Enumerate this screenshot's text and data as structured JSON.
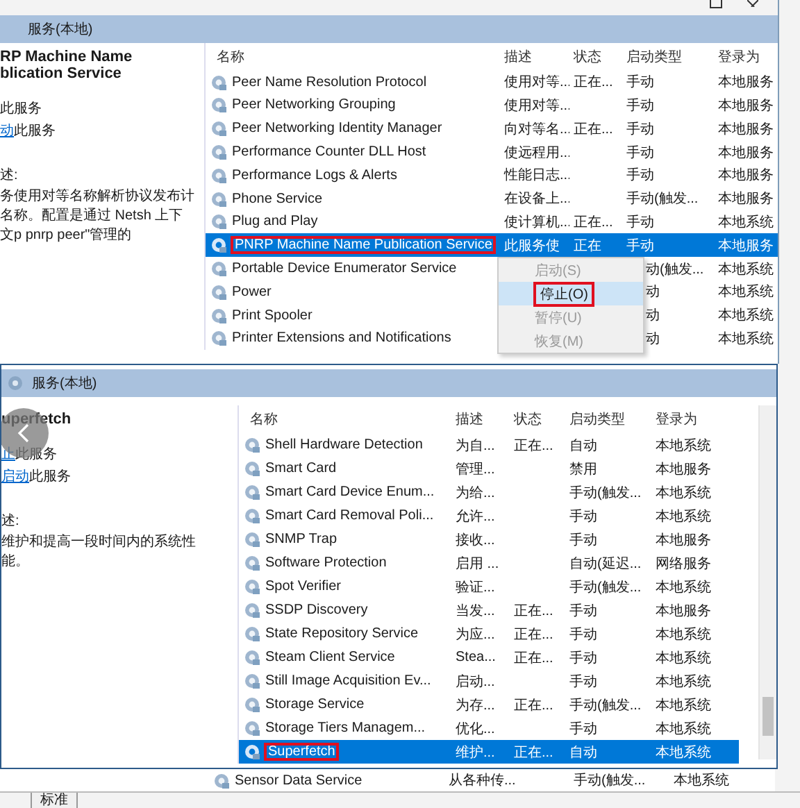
{
  "top_window": {
    "header": "服务(本地)",
    "details": {
      "title": "RP Machine Name\nblication Service",
      "actions": [
        {
          "text": "此服务"
        },
        {
          "link": "动",
          "text": "此服务"
        }
      ],
      "desc_label": "述:",
      "description": "务使用对等名称解析协议发布计名称。配置是通过 Netsh 上下文p pnrp peer\"管理的"
    },
    "columns": [
      "名称",
      "描述",
      "状态",
      "启动类型",
      "登录为"
    ],
    "rows": [
      {
        "name": "Peer Name Resolution Protocol",
        "desc": "使用对等...",
        "status": "正在...",
        "startup": "手动",
        "logon": "本地服务",
        "selected": false,
        "marked": false
      },
      {
        "name": "Peer Networking Grouping",
        "desc": "使用对等...",
        "startup": "手动",
        "logon": "本地服务",
        "selected": false,
        "marked": false
      },
      {
        "name": "Peer Networking Identity Manager",
        "desc": "向对等名...",
        "status": "正在...",
        "startup": "手动",
        "logon": "本地服务",
        "selected": false,
        "marked": false
      },
      {
        "name": "Performance Counter DLL Host",
        "desc": "使远程用...",
        "startup": "手动",
        "logon": "本地服务",
        "selected": false,
        "marked": false
      },
      {
        "name": "Performance Logs & Alerts",
        "desc": "性能日志...",
        "startup": "手动",
        "logon": "本地服务",
        "selected": false,
        "marked": false
      },
      {
        "name": "Phone Service",
        "desc": "在设备上...",
        "startup": "手动(触发...",
        "logon": "本地服务",
        "selected": false,
        "marked": false
      },
      {
        "name": "Plug and Play",
        "desc": "使计算机...",
        "status": "正在...",
        "startup": "手动",
        "logon": "本地系统",
        "selected": false,
        "marked": false
      },
      {
        "name": "PNRP Machine Name Publication Service",
        "desc": "此服务使",
        "status": "正在",
        "startup": "手动",
        "logon": "本地服务",
        "selected": true,
        "marked": true
      },
      {
        "name": "Portable Device Enumerator Service",
        "startup": "动(触发...",
        "logon": "本地系统",
        "selected": false,
        "marked": false
      },
      {
        "name": "Power",
        "startup": "动",
        "logon": "本地系统",
        "selected": false,
        "marked": false
      },
      {
        "name": "Print Spooler",
        "startup": "动",
        "logon": "本地系统",
        "selected": false,
        "marked": false
      },
      {
        "name": "Printer Extensions and Notifications",
        "startup": "动",
        "logon": "本地系统",
        "selected": false,
        "marked": false
      }
    ],
    "context_menu": [
      {
        "label": "启动(S)",
        "disabled": true,
        "selected": false,
        "marked": false
      },
      {
        "label": "停止(O)",
        "disabled": false,
        "selected": true,
        "marked": true
      },
      {
        "label": "暂停(U)",
        "disabled": true,
        "selected": false,
        "marked": false
      },
      {
        "label": "恢复(M)",
        "disabled": true,
        "selected": false,
        "marked": false
      }
    ]
  },
  "bottom_window": {
    "header": "服务(本地)",
    "details": {
      "title": "uperfetch",
      "actions": [
        {
          "link": "止",
          "text": "此服务"
        },
        {
          "link": "启动",
          "text": "此服务"
        }
      ],
      "desc_label": "述:",
      "description": "维护和提高一段时间内的系统性能。"
    },
    "columns": [
      "名称",
      "描述",
      "状态",
      "启动类型",
      "登录为"
    ],
    "rows": [
      {
        "name": "Shell Hardware Detection",
        "desc": "为自...",
        "status": "正在...",
        "startup": "自动",
        "logon": "本地系统",
        "selected": false,
        "marked": false
      },
      {
        "name": "Smart Card",
        "desc": "管理...",
        "startup": "禁用",
        "logon": "本地服务",
        "selected": false,
        "marked": false
      },
      {
        "name": "Smart Card Device Enum...",
        "desc": "为给...",
        "startup": "手动(触发...",
        "logon": "本地系统",
        "selected": false,
        "marked": false
      },
      {
        "name": "Smart Card Removal Poli...",
        "desc": "允许...",
        "startup": "手动",
        "logon": "本地系统",
        "selected": false,
        "marked": false
      },
      {
        "name": "SNMP Trap",
        "desc": "接收...",
        "startup": "手动",
        "logon": "本地服务",
        "selected": false,
        "marked": false
      },
      {
        "name": "Software Protection",
        "desc": "启用 ...",
        "startup": "自动(延迟...",
        "logon": "网络服务",
        "selected": false,
        "marked": false
      },
      {
        "name": "Spot Verifier",
        "desc": "验证...",
        "startup": "手动(触发...",
        "logon": "本地系统",
        "selected": false,
        "marked": false
      },
      {
        "name": "SSDP Discovery",
        "desc": "当发...",
        "status": "正在...",
        "startup": "手动",
        "logon": "本地服务",
        "selected": false,
        "marked": false
      },
      {
        "name": "State Repository Service",
        "desc": "为应...",
        "status": "正在...",
        "startup": "手动",
        "logon": "本地系统",
        "selected": false,
        "marked": false
      },
      {
        "name": "Steam Client Service",
        "desc": "Stea...",
        "status": "正在...",
        "startup": "手动",
        "logon": "本地系统",
        "selected": false,
        "marked": false
      },
      {
        "name": "Still Image Acquisition Ev...",
        "desc": "启动...",
        "startup": "手动",
        "logon": "本地系统",
        "selected": false,
        "marked": false
      },
      {
        "name": "Storage Service",
        "desc": "为存...",
        "status": "正在...",
        "startup": "手动(触发...",
        "logon": "本地系统",
        "selected": false,
        "marked": false
      },
      {
        "name": "Storage Tiers Managem...",
        "desc": "优化...",
        "startup": "手动",
        "logon": "本地系统",
        "selected": false,
        "marked": false
      },
      {
        "name": "Superfetch",
        "desc": "维护...",
        "status": "正在...",
        "startup": "自动",
        "logon": "本地系统",
        "selected": true,
        "marked": true
      }
    ]
  },
  "behind_row": {
    "name": "Sensor Data Service",
    "desc": "从各种传...",
    "startup": "手动(触发...",
    "logon": "本地系统"
  },
  "bottom_tabs": [
    {
      "label": "标准",
      "selected": false
    }
  ]
}
